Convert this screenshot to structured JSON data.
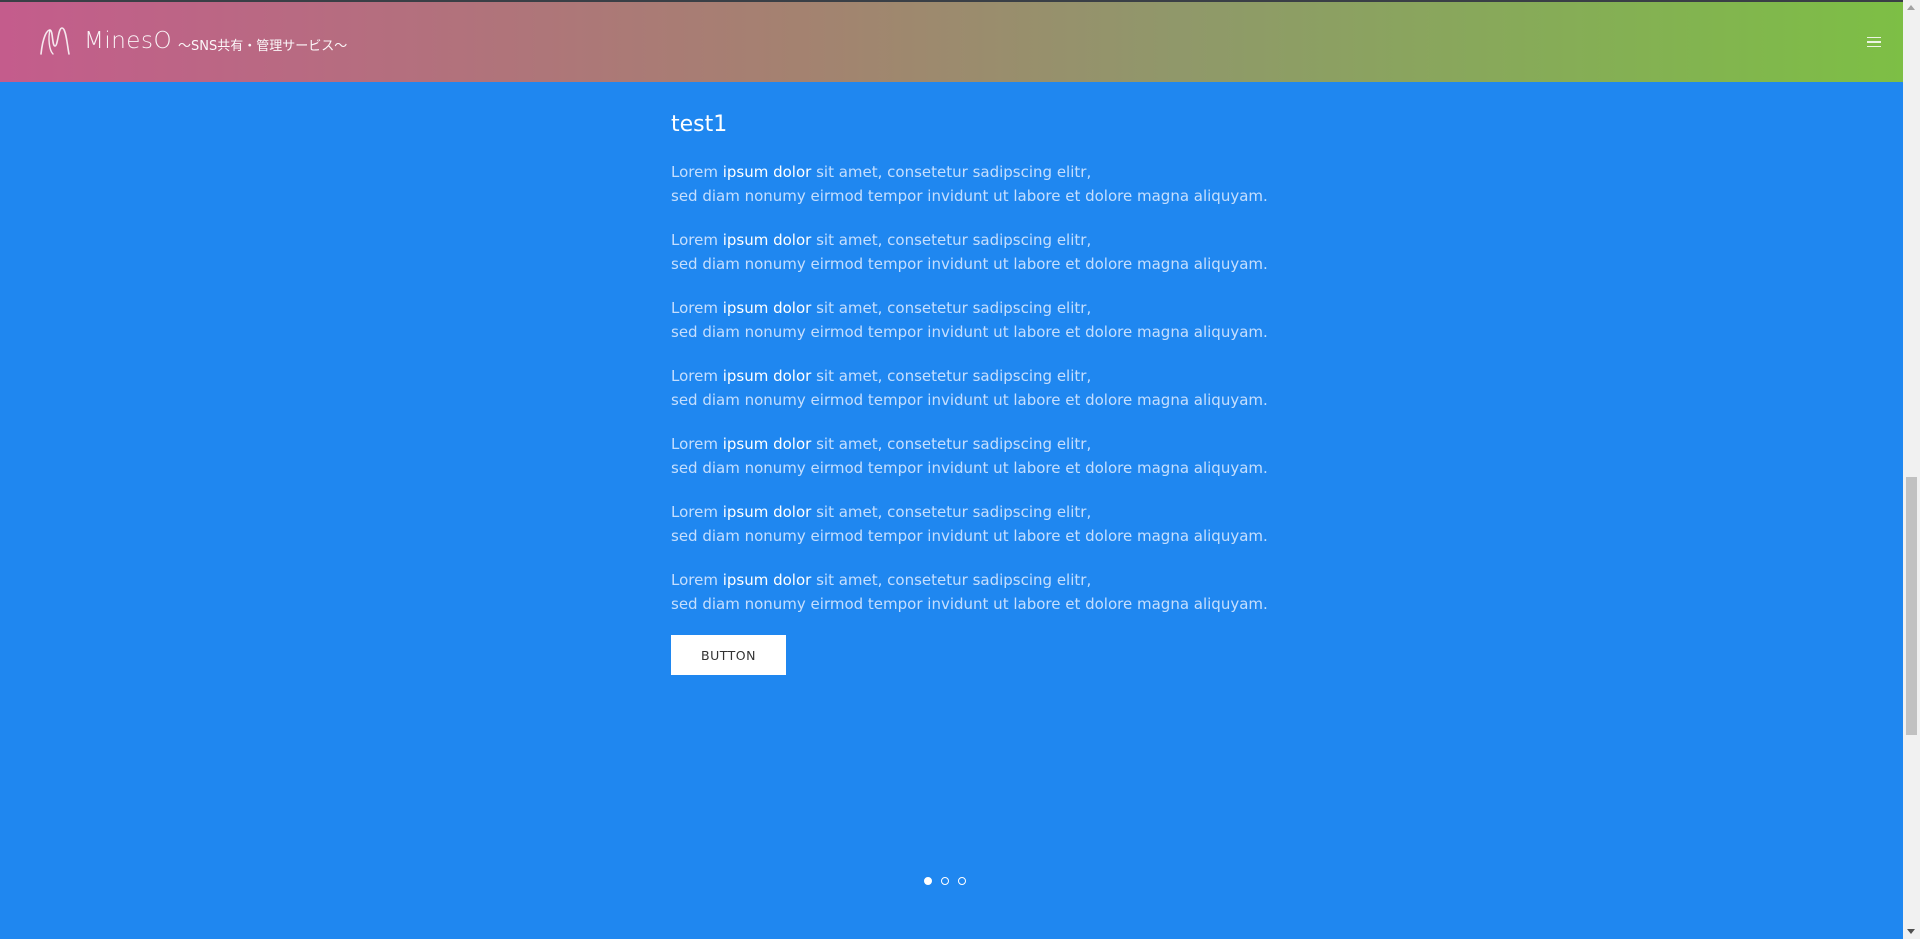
{
  "header": {
    "brand": "MinesO",
    "tagline": "～SNS共有・管理サービス～",
    "icons": {
      "logo": "mineso-logo-icon",
      "menu": "hamburger-menu-icon"
    }
  },
  "section": {
    "title": "test1",
    "paragraphs": [
      {
        "pre": "Lorem ",
        "strong": "ipsum dolor",
        "post": " sit amet, consetetur sadipscing elitr,",
        "line2": "sed diam nonumy eirmod tempor invidunt ut labore et dolore magna aliquyam."
      },
      {
        "pre": "Lorem ",
        "strong": "ipsum dolor",
        "post": " sit amet, consetetur sadipscing elitr,",
        "line2": "sed diam nonumy eirmod tempor invidunt ut labore et dolore magna aliquyam."
      },
      {
        "pre": "Lorem ",
        "strong": "ipsum dolor",
        "post": " sit amet, consetetur sadipscing elitr,",
        "line2": "sed diam nonumy eirmod tempor invidunt ut labore et dolore magna aliquyam."
      },
      {
        "pre": "Lorem ",
        "strong": "ipsum dolor",
        "post": " sit amet, consetetur sadipscing elitr,",
        "line2": "sed diam nonumy eirmod tempor invidunt ut labore et dolore magna aliquyam."
      },
      {
        "pre": "Lorem ",
        "strong": "ipsum dolor",
        "post": " sit amet, consetetur sadipscing elitr,",
        "line2": "sed diam nonumy eirmod tempor invidunt ut labore et dolore magna aliquyam."
      },
      {
        "pre": "Lorem ",
        "strong": "ipsum dolor",
        "post": " sit amet, consetetur sadipscing elitr,",
        "line2": "sed diam nonumy eirmod tempor invidunt ut labore et dolore magna aliquyam."
      },
      {
        "pre": "Lorem ",
        "strong": "ipsum dolor",
        "post": " sit amet, consetetur sadipscing elitr,",
        "line2": "sed diam nonumy eirmod tempor invidunt ut labore et dolore magna aliquyam."
      }
    ],
    "button_label": "BUTTON"
  },
  "pager": {
    "count": 3,
    "active_index": 0
  },
  "colors": {
    "background": "#1f87f0",
    "header_gradient_start": "#c45c8c",
    "header_gradient_end": "#7dbf45",
    "button_bg": "#ffffff"
  }
}
